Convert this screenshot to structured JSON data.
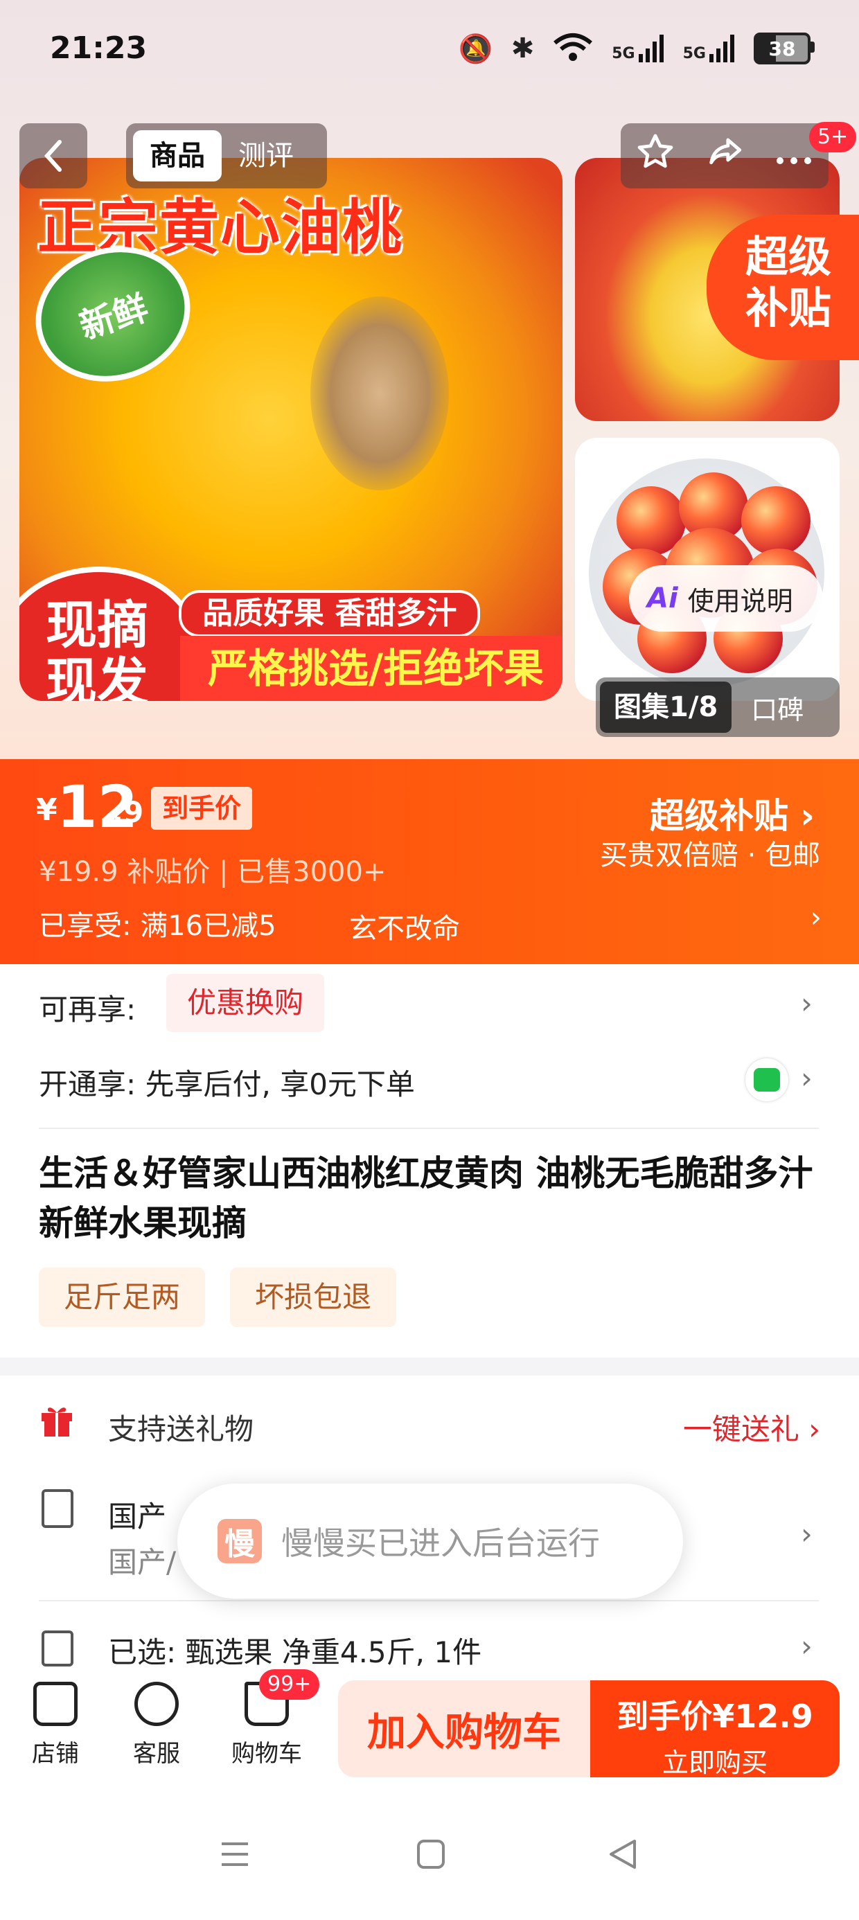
{
  "status_bar": {
    "time": "21:23",
    "battery": "38",
    "signal1": "5G",
    "signal2": "5G"
  },
  "top_nav": {
    "tabs": [
      "商品",
      "测评"
    ],
    "notification_badge": "5+"
  },
  "gallery": {
    "main_title": "正宗黄心油桃",
    "fresh_badge": "新鲜",
    "pick_badge_line1": "现摘",
    "pick_badge_line2": "现发",
    "quality_text": "品质好果 香甜多汁",
    "strict_text": "严格挑选/拒绝坏果",
    "subsidy_line1": "超级",
    "subsidy_line2": "补贴",
    "ai_label": "使用说明",
    "ai_icon": "Ai",
    "counter": "图集1/8",
    "reviews_tab": "口碑"
  },
  "price": {
    "currency": "¥",
    "integer": "12",
    "decimal": ".9",
    "tag": "到手价",
    "original_line": "¥19.9  补贴价 | 已售3000+",
    "enjoyed": "已享受: 满16已减5",
    "enjoyed_extra": "玄不改命",
    "super_subsidy": "超级补贴 ›",
    "super_desc": "买贵双倍赔 · 包邮"
  },
  "offers": {
    "more_label": "可再享:",
    "coupon": "优惠换购",
    "open_label": "开通享: 先享后付, 享0元下单"
  },
  "product": {
    "title": "生活＆好管家山西油桃红皮黄肉 油桃无毛脆甜多汁 新鲜水果现摘",
    "tags": [
      "足斤足两",
      "坏损包退"
    ]
  },
  "details": {
    "gift_label": "支持送礼物",
    "gift_action": "一键送礼 ›",
    "origin_label": "国产",
    "origin_sub": "国产/",
    "selected": "已选: 甄选果 净重4.5斤, 1件"
  },
  "toast": {
    "logo": "慢",
    "text": "慢慢买已进入后台运行"
  },
  "bottom_bar": {
    "store": "店铺",
    "service": "客服",
    "cart": "购物车",
    "cart_badge": "99+",
    "add_cart": "加入购物车",
    "buy_main": "到手价¥12.9",
    "buy_sub": "立即购买"
  },
  "colors": {
    "accent": "#ff4a12",
    "red": "#e3242b",
    "green": "#1fc04d"
  }
}
